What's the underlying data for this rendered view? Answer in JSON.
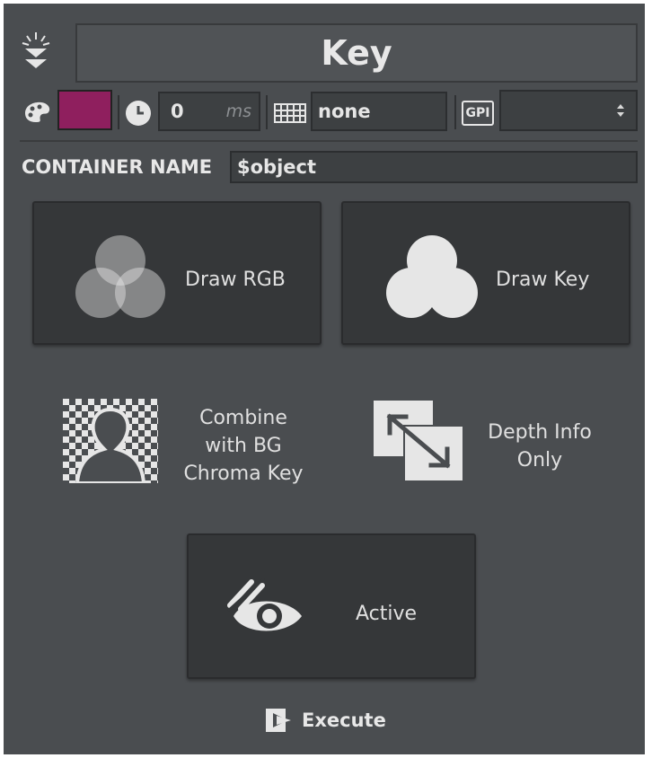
{
  "header": {
    "title": "Key",
    "color_swatch": "#8f1f5e",
    "delay_value": "0",
    "delay_unit": "ms",
    "keyboard_value": "none",
    "gpi_label": "GPI",
    "gpi_value": ""
  },
  "container": {
    "label": "CONTAINER NAME",
    "value": "$object"
  },
  "buttons": {
    "draw_rgb": "Draw RGB",
    "draw_key": "Draw Key",
    "combine_bg": [
      "Combine",
      "with BG",
      "Chroma Key"
    ],
    "depth_info": [
      "Depth Info",
      "Only"
    ],
    "active": "Active"
  },
  "footer": {
    "execute_label": "Execute"
  },
  "icons": [
    "light-icon",
    "palette-icon",
    "clock-icon",
    "keyboard-icon",
    "gpi-icon",
    "rgb-circles-icon",
    "key-cloud-icon",
    "chroma-person-icon",
    "depth-arrows-icon",
    "eye-slash-icon",
    "execute-icon"
  ]
}
